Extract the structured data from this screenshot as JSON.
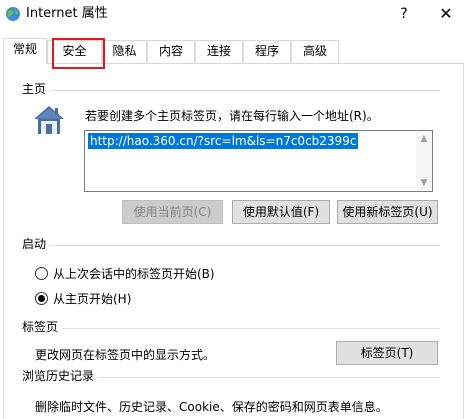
{
  "window": {
    "title": "Internet 属性",
    "help_label": "?",
    "close_label": "✕"
  },
  "tabs": [
    {
      "label": "常规",
      "active": true
    },
    {
      "label": "安全",
      "active": false
    },
    {
      "label": "隐私",
      "active": false
    },
    {
      "label": "内容",
      "active": false
    },
    {
      "label": "连接",
      "active": false
    },
    {
      "label": "程序",
      "active": false
    },
    {
      "label": "高级",
      "active": false
    }
  ],
  "home_page": {
    "group_label": "主页",
    "instruction": "若要创建多个主页标签页，请在每行输入一个地址(R)。",
    "url_value": "http://hao.360.cn/?src=lm&ls=n7c0cb2399c",
    "buttons": {
      "use_current": "使用当前页(C)",
      "use_default": "使用默认值(F)",
      "use_new_tab": "使用新标签页(U)"
    }
  },
  "startup": {
    "group_label": "启动",
    "options": [
      {
        "label": "从上次会话中的标签页开始(B)",
        "checked": false
      },
      {
        "label": "从主页开始(H)",
        "checked": true
      }
    ]
  },
  "tabs_section": {
    "group_label": "标签页",
    "description": "更改网页在标签页中的显示方式。",
    "button": "标签页(T)"
  },
  "history": {
    "group_label": "浏览历史记录",
    "description": "删除临时文件、历史记录、Cookie、保存的密码和网页表单信息。"
  },
  "colors": {
    "highlight_box": "#e0191f",
    "selection": "#0078d7"
  }
}
